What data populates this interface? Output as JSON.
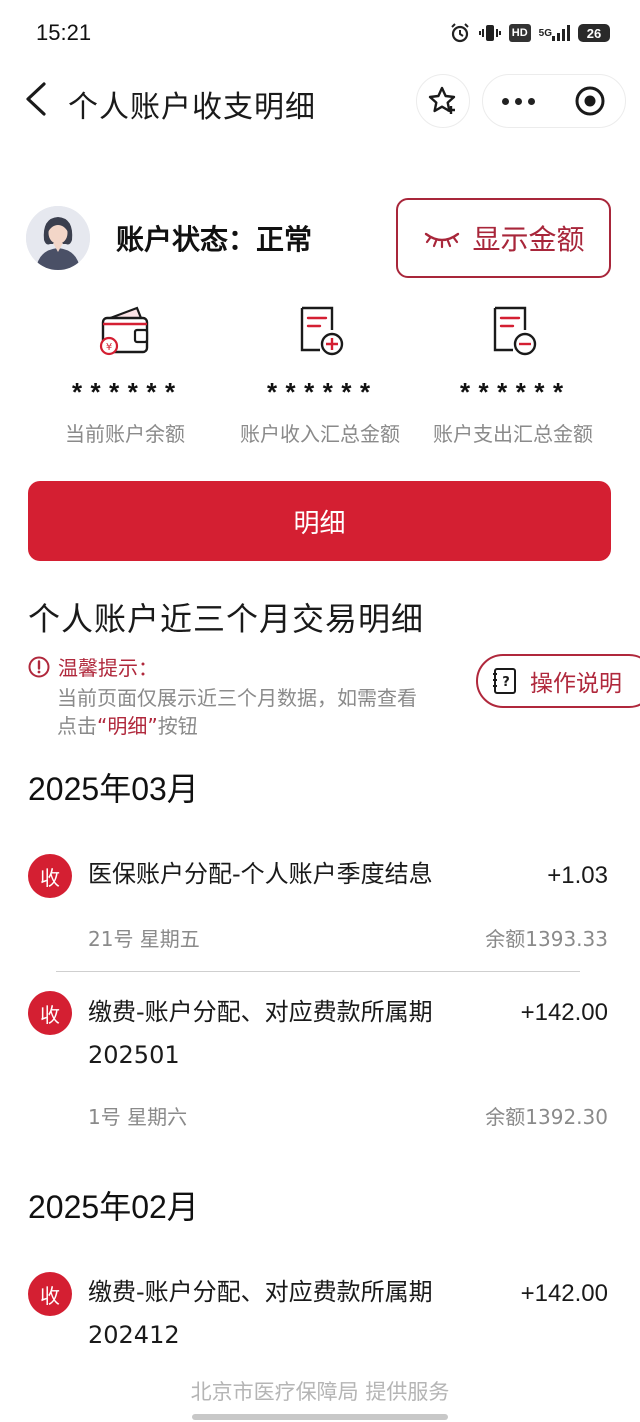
{
  "status_bar": {
    "time": "15:21",
    "network": "5G",
    "hd": "HD",
    "battery": "26"
  },
  "nav": {
    "title": "个人账户收支明细"
  },
  "account": {
    "status_text": "账户状态：正常",
    "show_amount_label": "显示金额"
  },
  "stats": [
    {
      "value": "******",
      "label": "当前账户余额",
      "icon": "wallet-icon"
    },
    {
      "value": "******",
      "label": "账户收入汇总金额",
      "icon": "income-doc-icon"
    },
    {
      "value": "******",
      "label": "账户支出汇总金额",
      "icon": "expense-doc-icon"
    }
  ],
  "detail_button": {
    "label": "明细"
  },
  "section": {
    "title": "个人账户近三个月交易明细"
  },
  "tip": {
    "title": "温馨提示：",
    "line1": "当前页面仅展示近三个月数据，如需查看",
    "line2_prefix": "点击",
    "line2_highlight": "“明细”",
    "line2_suffix": "按钮"
  },
  "help_button": {
    "label": "操作说明"
  },
  "months": [
    {
      "label": "2025年03月",
      "transactions": [
        {
          "badge": "收",
          "desc": "医保账户分配-个人账户季度结息",
          "amount": "+1.03",
          "date": "21号 星期五",
          "balance": "余额1393.33"
        },
        {
          "badge": "收",
          "desc": "缴费-账户分配、对应费款所属期202501",
          "amount": "+142.00",
          "date": "1号 星期六",
          "balance": "余额1392.30"
        }
      ]
    },
    {
      "label": "2025年02月",
      "transactions": [
        {
          "badge": "收",
          "desc": "缴费-账户分配、对应费款所属期202412",
          "amount": "+142.00"
        }
      ]
    }
  ],
  "footer": {
    "text": "北京市医疗保障局  提供服务"
  },
  "colors": {
    "brand_red": "#d41f32",
    "dark_red": "#a8263a",
    "grey_text": "#8a8a8a"
  }
}
